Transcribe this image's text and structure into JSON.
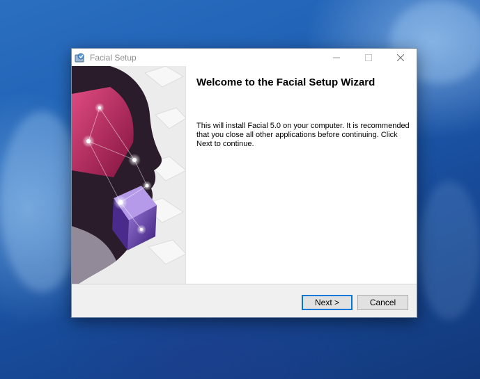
{
  "window": {
    "title": "Facial Setup",
    "icon": "installer-icon",
    "controls": [
      "minimize-icon",
      "maximize-icon",
      "close-icon"
    ]
  },
  "wizard": {
    "heading": "Welcome to the Facial Setup Wizard",
    "body": "This will install Facial 5.0 on your computer. It is recommended that you close all other applications before continuing. Click Next to continue.",
    "banner": "wizard-banner-image"
  },
  "buttons": {
    "next": "Next >",
    "cancel": "Cancel"
  },
  "colors": {
    "accent": "#0078d7",
    "button_face": "#e1e1e1",
    "desktop": "#1f5fb3"
  }
}
